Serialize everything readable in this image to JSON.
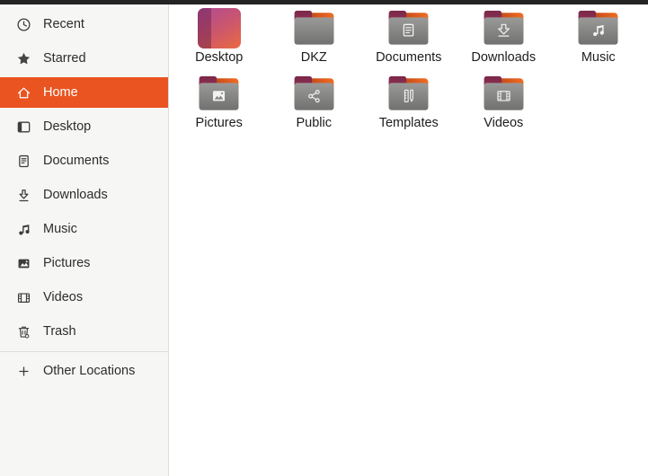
{
  "sidebar": {
    "items": [
      {
        "id": "recent",
        "label": "Recent",
        "selected": false
      },
      {
        "id": "starred",
        "label": "Starred",
        "selected": false
      },
      {
        "id": "home",
        "label": "Home",
        "selected": true
      },
      {
        "id": "desktop",
        "label": "Desktop",
        "selected": false
      },
      {
        "id": "documents",
        "label": "Documents",
        "selected": false
      },
      {
        "id": "downloads",
        "label": "Downloads",
        "selected": false
      },
      {
        "id": "music",
        "label": "Music",
        "selected": false
      },
      {
        "id": "pictures",
        "label": "Pictures",
        "selected": false
      },
      {
        "id": "videos",
        "label": "Videos",
        "selected": false
      },
      {
        "id": "trash",
        "label": "Trash",
        "selected": false
      }
    ],
    "other_locations": {
      "label": "Other Locations"
    },
    "selected_item": "Home"
  },
  "content": {
    "folders": [
      {
        "label": "Desktop",
        "icon": "desktop-gradient-icon"
      },
      {
        "label": "DKZ",
        "icon": "folder-plain-icon"
      },
      {
        "label": "Documents",
        "icon": "folder-documents-icon"
      },
      {
        "label": "Downloads",
        "icon": "folder-downloads-icon"
      },
      {
        "label": "Music",
        "icon": "folder-music-icon"
      },
      {
        "label": "Pictures",
        "icon": "folder-pictures-icon"
      },
      {
        "label": "Public",
        "icon": "folder-public-icon"
      },
      {
        "label": "Templates",
        "icon": "folder-templates-icon"
      },
      {
        "label": "Videos",
        "icon": "folder-videos-icon"
      }
    ]
  },
  "colors": {
    "accent": "#E95420",
    "topbar_bg": "#242424",
    "sidebar_bg": "#f6f6f5",
    "content_bg": "#ffffff",
    "folder_front_gray": "#8a8a89",
    "folder_tab_aubergine": "#7e2a4c",
    "folder_back_orange": "#e95420",
    "selected_text": "#ffffff",
    "text": "#2d2d2d"
  }
}
